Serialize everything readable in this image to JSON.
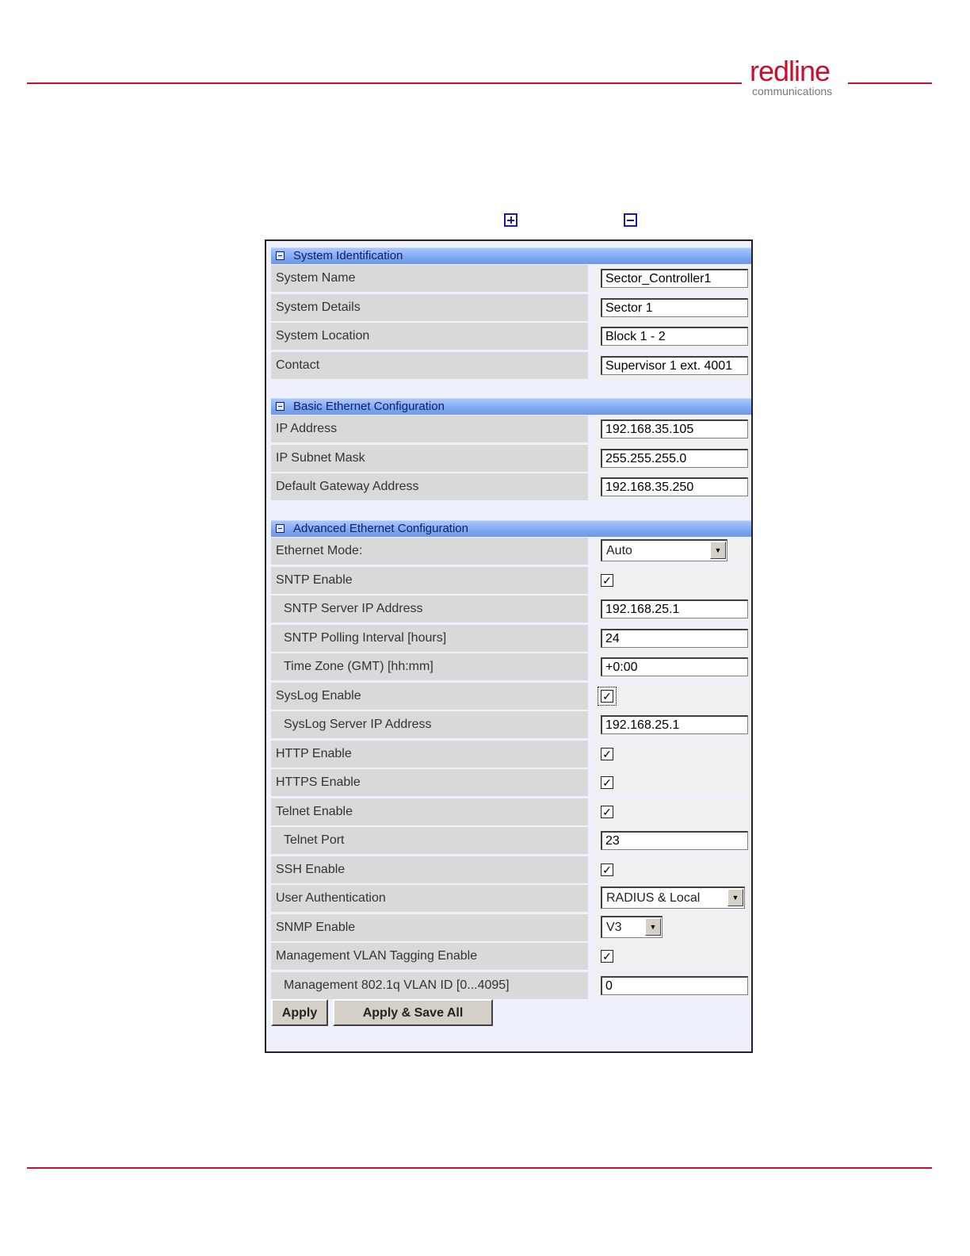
{
  "header": {
    "logo_word": "redline",
    "logo_sub": "communications",
    "brand_color": "#c8102e"
  },
  "icons": [
    "expand-all-icon",
    "collapse-all-icon"
  ],
  "sections": [
    {
      "title": "System Identification",
      "rows": [
        {
          "label": "System Name",
          "type": "text",
          "value": "Sector_Controller1"
        },
        {
          "label": "System Details",
          "type": "text",
          "value": "Sector 1"
        },
        {
          "label": "System Location",
          "type": "text",
          "value": "Block 1 - 2"
        },
        {
          "label": "Contact",
          "type": "text",
          "value": "Supervisor 1 ext. 4001"
        }
      ]
    },
    {
      "title": "Basic Ethernet Configuration",
      "rows": [
        {
          "label": "IP Address",
          "type": "text",
          "value": "192.168.35.105"
        },
        {
          "label": "IP Subnet Mask",
          "type": "text",
          "value": "255.255.255.0"
        },
        {
          "label": "Default Gateway Address",
          "type": "text",
          "value": "192.168.35.250"
        }
      ]
    },
    {
      "title": "Advanced Ethernet Configuration",
      "rows": [
        {
          "label": "Ethernet Mode:",
          "type": "select",
          "value": "Auto"
        },
        {
          "label": "SNTP Enable",
          "type": "checkbox",
          "checked": true
        },
        {
          "label": "SNTP Server IP Address",
          "type": "text",
          "value": "192.168.25.1",
          "indent": true
        },
        {
          "label": "SNTP Polling Interval [hours]",
          "type": "text",
          "value": "24",
          "indent": true
        },
        {
          "label": "Time Zone (GMT) [hh:mm]",
          "type": "text",
          "value": "+0:00",
          "indent": true
        },
        {
          "label": "SysLog Enable",
          "type": "checkbox",
          "checked": true,
          "focused": true
        },
        {
          "label": "SysLog Server IP Address",
          "type": "text",
          "value": "192.168.25.1",
          "indent": true
        },
        {
          "label": "HTTP Enable",
          "type": "checkbox",
          "checked": true
        },
        {
          "label": "HTTPS Enable",
          "type": "checkbox",
          "checked": true
        },
        {
          "label": "Telnet Enable",
          "type": "checkbox",
          "checked": true
        },
        {
          "label": "Telnet Port",
          "type": "text",
          "value": "23",
          "indent": true
        },
        {
          "label": "SSH Enable",
          "type": "checkbox",
          "checked": true
        },
        {
          "label": "User Authentication",
          "type": "select",
          "value": "RADIUS & Local"
        },
        {
          "label": "SNMP Enable",
          "type": "select",
          "value": "V3"
        },
        {
          "label": "Management VLAN Tagging Enable",
          "type": "checkbox",
          "checked": true
        },
        {
          "label": "Management 802.1q VLAN ID [0...4095]",
          "type": "text",
          "value": "0",
          "indent": true
        }
      ]
    }
  ],
  "buttons": {
    "apply": "Apply",
    "apply_save_all": "Apply & Save All"
  }
}
